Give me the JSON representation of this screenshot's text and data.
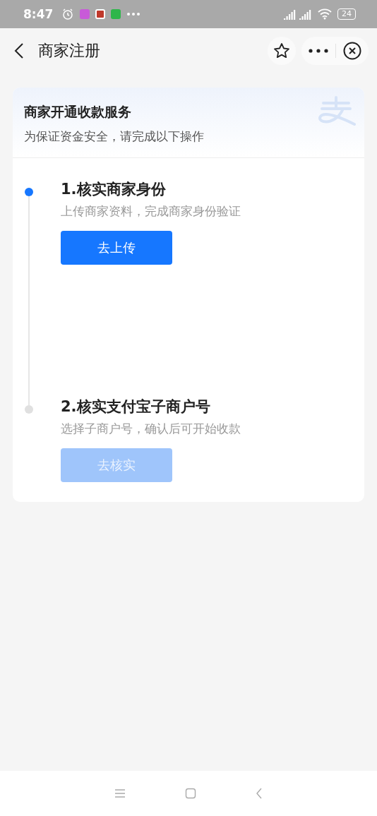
{
  "status_bar": {
    "time": "8:47",
    "battery": "24"
  },
  "nav": {
    "title": "商家注册"
  },
  "card": {
    "title": "商家开通收款服务",
    "subtitle": "为保证资金安全，请完成以下操作"
  },
  "steps": [
    {
      "title": "1.核实商家身份",
      "description": "上传商家资料，完成商家身份验证",
      "button": "去上传",
      "active": true,
      "disabled": false
    },
    {
      "title": "2.核实支付宝子商户号",
      "description": "选择子商户号，确认后可开始收款",
      "button": "去核实",
      "active": false,
      "disabled": true
    }
  ]
}
